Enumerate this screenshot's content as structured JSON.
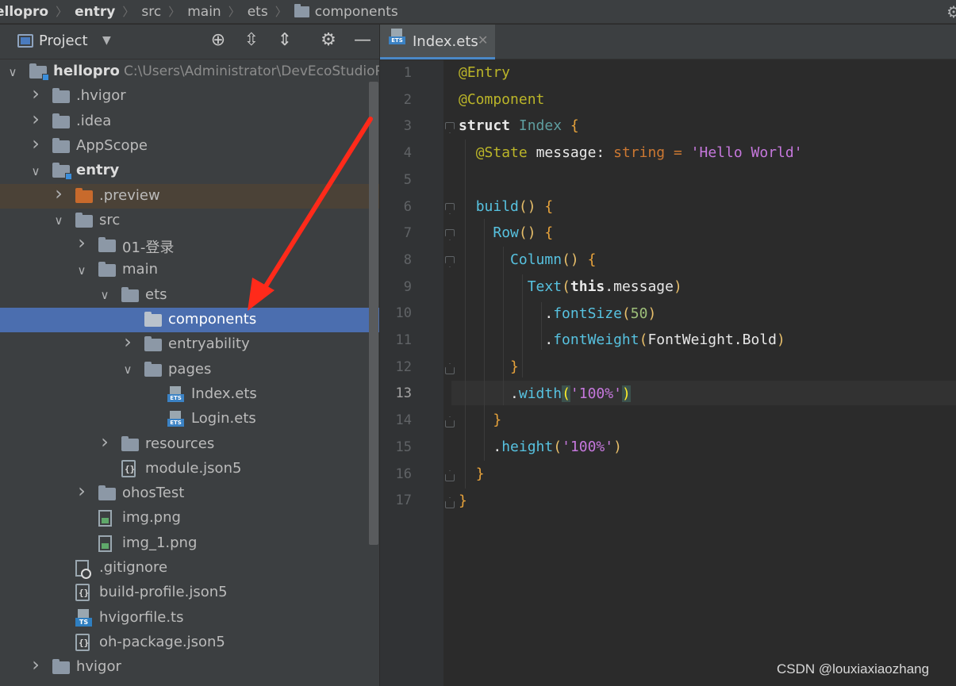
{
  "breadcrumb": [
    "ellopro",
    "entry",
    "src",
    "main",
    "ets",
    "components"
  ],
  "project_panel": {
    "title": "Project",
    "header_icons": [
      "locate-icon",
      "expand-all-icon",
      "collapse-all-icon",
      "gear-icon",
      "minimize-icon"
    ],
    "tree": [
      {
        "label": "hellopro",
        "hint": "C:\\Users\\Administrator\\DevEcoStudioPro",
        "depth": 0,
        "arrow": "down",
        "icon": "module-folder",
        "bold": true
      },
      {
        "label": ".hvigor",
        "depth": 1,
        "arrow": "right",
        "icon": "folder"
      },
      {
        "label": ".idea",
        "depth": 1,
        "arrow": "right",
        "icon": "folder"
      },
      {
        "label": "AppScope",
        "depth": 1,
        "arrow": "right",
        "icon": "folder"
      },
      {
        "label": "entry",
        "depth": 1,
        "arrow": "down",
        "icon": "module-folder",
        "bold": true
      },
      {
        "label": ".preview",
        "depth": 2,
        "arrow": "right",
        "icon": "orange-folder",
        "state": "preview"
      },
      {
        "label": "src",
        "depth": 2,
        "arrow": "down",
        "icon": "folder"
      },
      {
        "label": "01-登录",
        "depth": 3,
        "arrow": "right",
        "icon": "folder"
      },
      {
        "label": "main",
        "depth": 3,
        "arrow": "down",
        "icon": "folder"
      },
      {
        "label": "ets",
        "depth": 4,
        "arrow": "down",
        "icon": "folder"
      },
      {
        "label": "components",
        "depth": 5,
        "arrow": "",
        "icon": "light-folder",
        "state": "selected"
      },
      {
        "label": "entryability",
        "depth": 5,
        "arrow": "right",
        "icon": "folder"
      },
      {
        "label": "pages",
        "depth": 5,
        "arrow": "down",
        "icon": "folder"
      },
      {
        "label": "Index.ets",
        "depth": 6,
        "arrow": "",
        "icon": "ets-file"
      },
      {
        "label": "Login.ets",
        "depth": 6,
        "arrow": "",
        "icon": "ets-file"
      },
      {
        "label": "resources",
        "depth": 4,
        "arrow": "right",
        "icon": "folder"
      },
      {
        "label": "module.json5",
        "depth": 4,
        "arrow": "",
        "icon": "json-file"
      },
      {
        "label": "ohosTest",
        "depth": 3,
        "arrow": "right",
        "icon": "folder"
      },
      {
        "label": "img.png",
        "depth": 3,
        "arrow": "",
        "icon": "png-file"
      },
      {
        "label": "img_1.png",
        "depth": 3,
        "arrow": "",
        "icon": "png-file"
      },
      {
        "label": ".gitignore",
        "depth": 2,
        "arrow": "",
        "icon": "gitignore-file"
      },
      {
        "label": "build-profile.json5",
        "depth": 2,
        "arrow": "",
        "icon": "json-file"
      },
      {
        "label": "hvigorfile.ts",
        "depth": 2,
        "arrow": "",
        "icon": "ts-file"
      },
      {
        "label": "oh-package.json5",
        "depth": 2,
        "arrow": "",
        "icon": "json-file"
      },
      {
        "label": "hvigor",
        "depth": 1,
        "arrow": "right",
        "icon": "folder"
      }
    ]
  },
  "editor": {
    "tab_label": "Index.ets",
    "tab_badge": "ETS",
    "current_line": 13,
    "line_numbers": [
      "1",
      "2",
      "3",
      "4",
      "5",
      "6",
      "7",
      "8",
      "9",
      "10",
      "11",
      "12",
      "13",
      "14",
      "15",
      "16",
      "17"
    ],
    "code": {
      "l1_ann": "@Entry",
      "l2_ann": "@Component",
      "l3_kw": "struct",
      "l3_cls": "Index",
      "l3_brace": "{",
      "l4_ann": "@State",
      "l4_name": "message:",
      "l4_type": "string",
      "l4_eq": "=",
      "l4_str": "'Hello World'",
      "l6_fn": "build",
      "l6_paren": "()",
      "l6_brace": "{",
      "l7_fn": "Row",
      "l7_paren": "()",
      "l7_brace": "{",
      "l8_fn": "Column",
      "l8_paren": "()",
      "l8_brace": "{",
      "l9_fn": "Text",
      "l9_open": "(",
      "l9_this": "this",
      "l9_rest": ".message",
      "l9_close": ")",
      "l10_dot": ".",
      "l10_fn": "fontSize",
      "l10_open": "(",
      "l10_num": "50",
      "l10_close": ")",
      "l11_dot": ".",
      "l11_fn": "fontWeight",
      "l11_open": "(",
      "l11_arg": "FontWeight.Bold",
      "l11_close": ")",
      "l12_brace": "}",
      "l13_dot": ".",
      "l13_fn": "width",
      "l13_open": "(",
      "l13_str": "'100%'",
      "l13_close": ")",
      "l14_brace": "}",
      "l15_dot": ".",
      "l15_fn": "height",
      "l15_open": "(",
      "l15_str": "'100%'",
      "l15_close": ")",
      "l16_brace": "}",
      "l17_brace": "}"
    }
  },
  "watermark": "CSDN @louxiaxiaozhang",
  "colors": {
    "selection": "#4b6eaf",
    "annotation_arrow": "#ff2a1a"
  }
}
